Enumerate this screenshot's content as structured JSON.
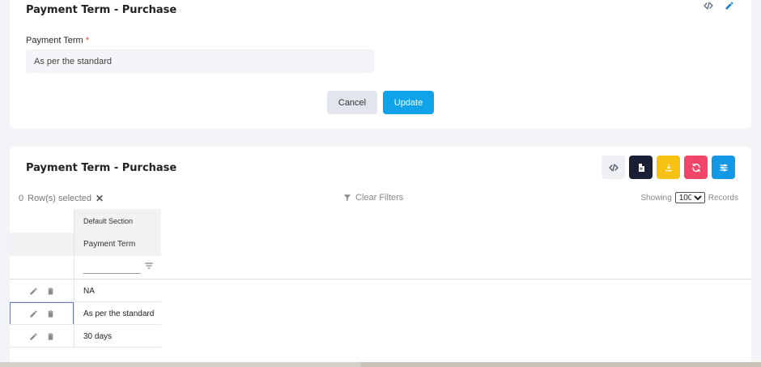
{
  "form_card": {
    "title": "Payment Term - Purchase",
    "field_label": "Payment Term",
    "required_mark": "*",
    "field_value": "As per the standard",
    "cancel_label": "Cancel",
    "update_label": "Update",
    "icons": [
      "code-icon",
      "pencil-icon"
    ]
  },
  "grid_card": {
    "title": "Payment Term - Purchase",
    "toolbar": [
      "code-icon",
      "document-icon",
      "download-icon",
      "refresh-icon",
      "settings-icon"
    ],
    "selected_count": "0",
    "selected_label": "Row(s) selected",
    "clear_filters_label": "Clear Filters",
    "showing_label": "Showing",
    "page_size": "100",
    "page_size_options": [
      "100"
    ],
    "records_label": "Records",
    "header_group": "Default Section",
    "columns": [
      "Payment Term"
    ],
    "rows": [
      {
        "payment_term": "NA"
      },
      {
        "payment_term": "As per the standard"
      },
      {
        "payment_term": "30 days"
      }
    ]
  },
  "colors": {
    "accent_blue": "#10a3ea",
    "dark": "#1a1f36",
    "yellow": "#f6c10f",
    "pink": "#ef4569",
    "required_red": "#e53935"
  }
}
